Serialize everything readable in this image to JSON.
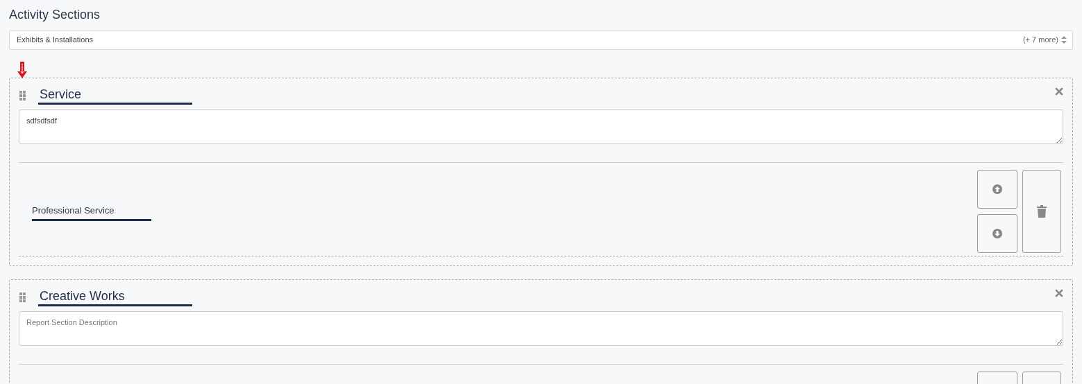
{
  "heading": "Activity Sections",
  "select": {
    "value": "Exhibits & Installations",
    "more": "(+ 7 more)"
  },
  "sections": [
    {
      "title": "Service",
      "marker": true,
      "description": "sdfsdfsdf",
      "entries": [
        {
          "kind": "named",
          "name": "Professional Service"
        }
      ]
    },
    {
      "title": "Creative Works",
      "marker": false,
      "placeholder": "Report Section Description",
      "entries": [
        {
          "kind": "unlabeled"
        }
      ]
    }
  ]
}
